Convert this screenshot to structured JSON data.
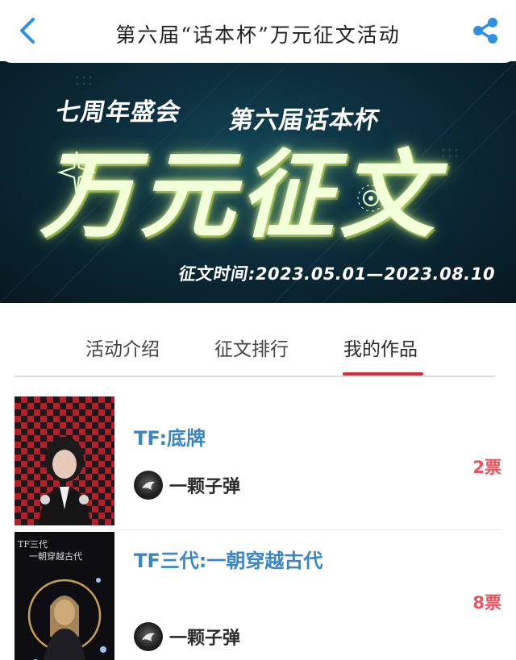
{
  "header": {
    "title": "第六届“话本杯”万元征文活动",
    "back_icon": "chevron-left-icon",
    "share_icon": "share-icon",
    "accent_color": "#2f8fe0"
  },
  "banner": {
    "subtitle_left": "七周年盛会",
    "subtitle_right": "第六届话本杯",
    "main_text": "万元征文",
    "date_text": "征文时间:2023.05.01—2023.08.10"
  },
  "tabs": [
    {
      "label": "活动介绍",
      "active": false
    },
    {
      "label": "征文排行",
      "active": false
    },
    {
      "label": "我的作品",
      "active": true
    }
  ],
  "entries": [
    {
      "title": "TF:底牌",
      "author": "一颗子弹",
      "votes": "2票"
    },
    {
      "title": "TF三代:一朝穿越古代",
      "author": "一颗子弹",
      "votes": "8票",
      "cover_text_line1": "TF三代",
      "cover_text_line2": "一朝穿越古代"
    }
  ],
  "colors": {
    "tab_indicator": "#d32f3a",
    "entry_title": "#3a86c4",
    "votes": "#e8545f"
  }
}
